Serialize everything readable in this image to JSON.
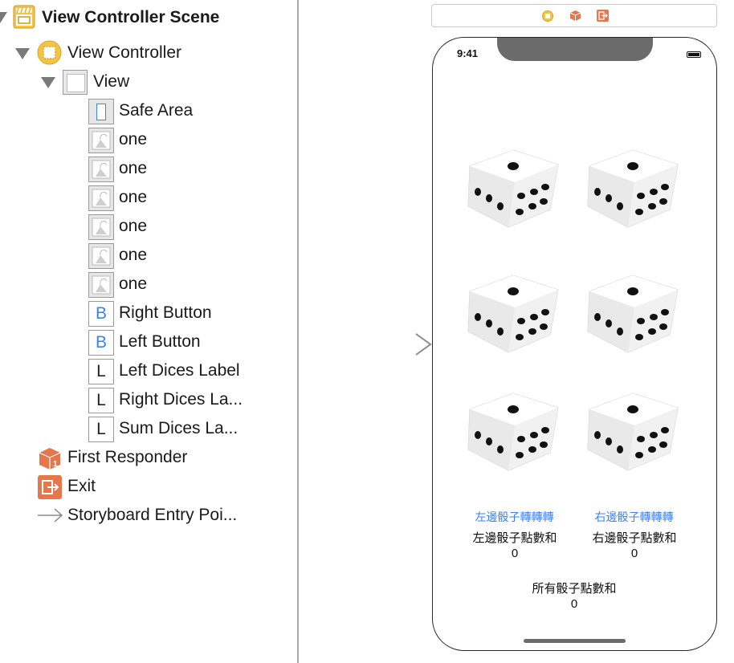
{
  "outline": {
    "scene_title": "View Controller Scene",
    "view_controller": "View Controller",
    "view": "View",
    "safe_area": "Safe Area",
    "image_views": [
      "one",
      "one",
      "one",
      "one",
      "one",
      "one"
    ],
    "right_button": "Right Button",
    "left_button": "Left Button",
    "left_label": "Left Dices Label",
    "right_label": "Right Dices La...",
    "sum_label": "Sum Dices La...",
    "first_responder": "First Responder",
    "exit": "Exit",
    "entry_point": "Storyboard Entry Poi...",
    "button_glyph": "B",
    "label_glyph": "L"
  },
  "phone": {
    "time": "9:41",
    "left_button": "左邊骰子轉轉轉",
    "right_button": "右邊骰子轉轉轉",
    "left_label": "左邊骰子點數和",
    "left_value": "0",
    "right_label": "右邊骰子點數和",
    "right_value": "0",
    "sum_label": "所有骰子點數和",
    "sum_value": "0"
  },
  "colors": {
    "accent_blue": "#3a82f6",
    "scene_yellow": "#f5c443",
    "responder_orange": "#e4774b",
    "exit_orange": "#e4774b"
  },
  "icons": {
    "scene": "storyboard-scene-icon",
    "view_controller": "view-controller-icon",
    "image_view": "image-view-icon",
    "first_responder": "first-responder-cube-icon",
    "exit": "exit-icon",
    "entry": "arrow-right-icon"
  }
}
